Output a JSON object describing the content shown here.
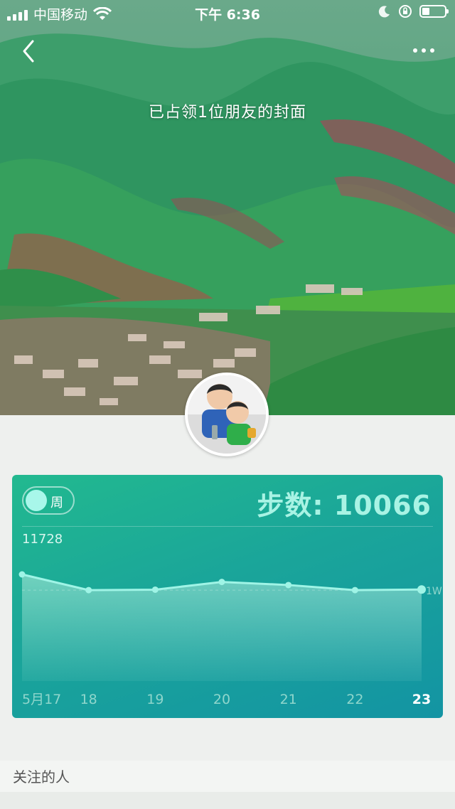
{
  "status_bar": {
    "carrier": "中国移动",
    "time": "下午 6:36"
  },
  "cover": {
    "title": "已占领1位朋友的封面"
  },
  "nav": {
    "back_icon": "chevron-left-icon",
    "more_icon": "ellipsis-icon"
  },
  "card": {
    "period_toggle_label": "周",
    "steps_text": "步数: 10066",
    "max_label": "11728",
    "ref_label": "1W",
    "colors": {
      "line": "#9ff4e6",
      "fill_top": "#b6efe0",
      "label_dim": "#8fd6cc",
      "label_active": "#ffffff"
    }
  },
  "chart_data": {
    "type": "area",
    "categories": [
      "5月17",
      "18",
      "19",
      "20",
      "21",
      "22",
      "23"
    ],
    "values": [
      11728,
      10000,
      10050,
      10900,
      10560,
      10000,
      10066
    ],
    "ylim": [
      0,
      11728
    ],
    "ref_line": 10000,
    "ref_line_label": "1W",
    "highlight_index": 6
  },
  "following": {
    "header": "关注的人"
  }
}
